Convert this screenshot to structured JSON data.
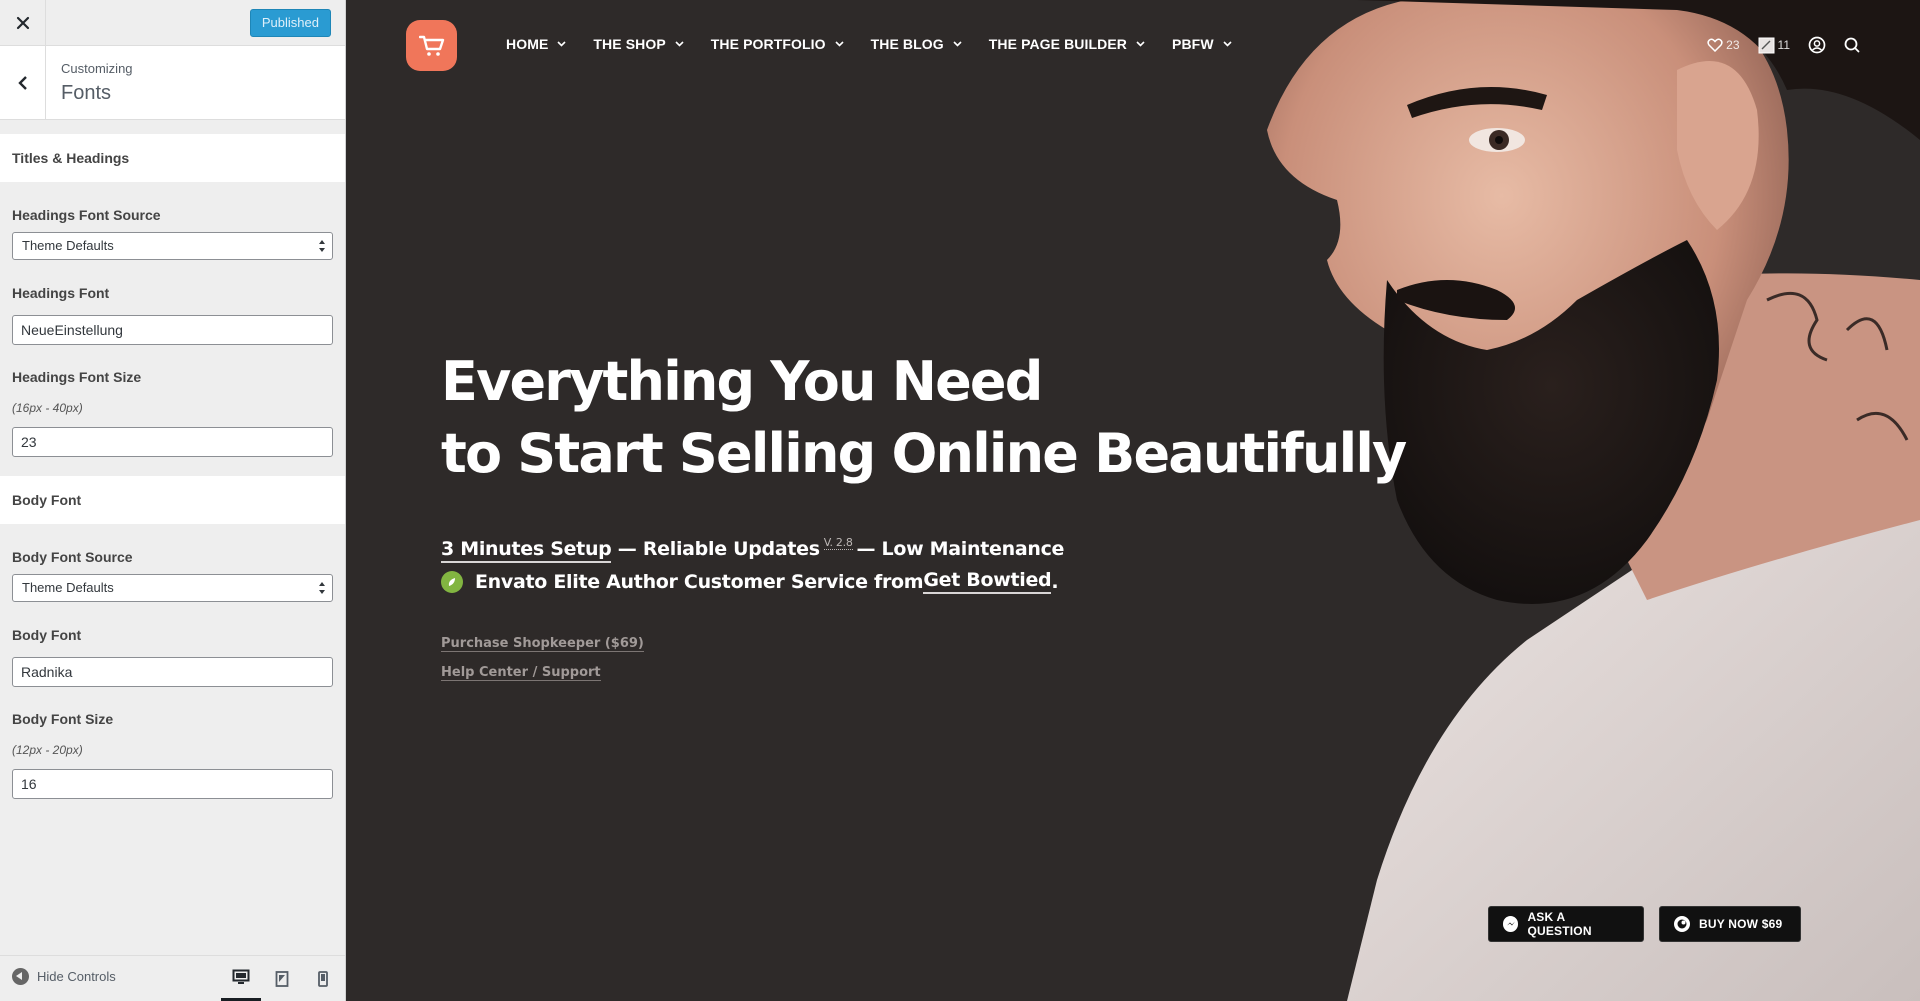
{
  "sidebar": {
    "close_icon": "close-icon",
    "publish_label": "Published",
    "breadcrumb": "Customizing",
    "section_title": "Fonts",
    "groups": {
      "titles_headings": "Titles & Headings",
      "body_font": "Body Font"
    },
    "headings": {
      "source_label": "Headings Font Source",
      "source_value": "Theme Defaults",
      "font_label": "Headings Font",
      "font_value": "NeueEinstellung",
      "size_label": "Headings Font Size",
      "size_desc": "(16px - 40px)",
      "size_value": "23"
    },
    "body": {
      "source_label": "Body Font Source",
      "source_value": "Theme Defaults",
      "font_label": "Body Font",
      "font_value": "Radnika",
      "size_label": "Body Font Size",
      "size_desc": "(12px - 20px)",
      "size_value": "16"
    },
    "footer": {
      "hide_controls": "Hide Controls",
      "devices": [
        "desktop",
        "tablet",
        "mobile"
      ],
      "active_device": "desktop"
    }
  },
  "preview": {
    "nav": [
      {
        "label": "HOME"
      },
      {
        "label": "THE SHOP"
      },
      {
        "label": "THE PORTFOLIO"
      },
      {
        "label": "THE BLOG"
      },
      {
        "label": "THE PAGE BUILDER"
      },
      {
        "label": "PBFW"
      }
    ],
    "header_icons": {
      "wishlist_count": "23",
      "cart_count": "11"
    },
    "headline": {
      "line1": "Everything You Need",
      "line2": "to Start Selling Online Beautifully"
    },
    "feature1": {
      "setup": "3 Minutes Setup",
      "sep1": " — Reliable Updates",
      "version": "V. 2.8",
      "sep2": "— Low Maintenance"
    },
    "feature2": {
      "text": "Envato Elite Author Customer Service from ",
      "link": "Get Bowtied",
      "end": "."
    },
    "links": {
      "purchase": "Purchase Shopkeeper ($69)",
      "help": "Help Center / Support"
    },
    "cta": {
      "ask": "ASK A QUESTION",
      "buy": "BUY NOW $69"
    },
    "colors": {
      "logo_bg": "#f0765a",
      "publish_bg": "#2a9bd2",
      "hero_bg": "#2e2a29",
      "envato_green": "#82b541"
    }
  }
}
